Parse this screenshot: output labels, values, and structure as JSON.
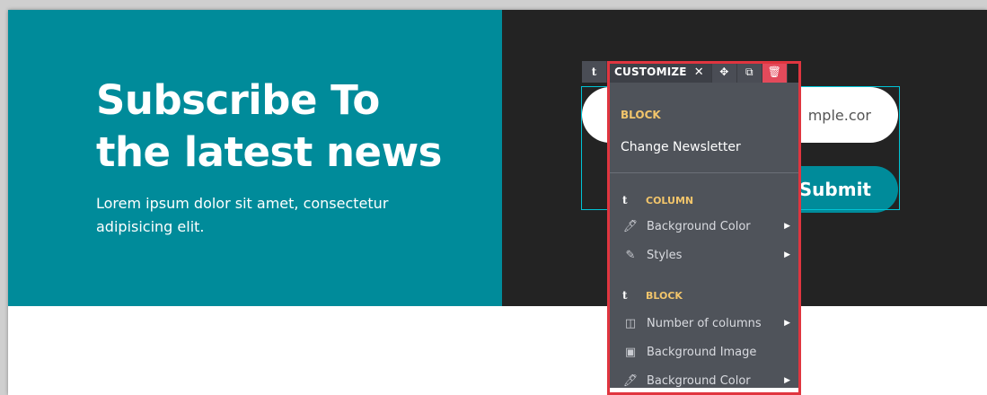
{
  "hero": {
    "headline_line1": "Subscribe To",
    "headline_line2": "the latest news",
    "lead": "Lorem ipsum dolor sit amet, consectetur adipisicing elit."
  },
  "form": {
    "email_value": "mple.cor",
    "submit_label": "Submit"
  },
  "toolbar": {
    "parent_icon": "t",
    "customize_label": "CUSTOMIZE",
    "close_glyph": "✕",
    "move_icon": "✥",
    "clone_icon": "⧉",
    "delete_icon": "🗑"
  },
  "menu": {
    "block_title": "BLOCK",
    "change_label": "Change Newsletter",
    "groups": [
      {
        "icon": "t",
        "title": "COLUMN",
        "items": [
          {
            "icon": "🖊",
            "label": "Background Color",
            "has_submenu": true
          },
          {
            "icon": "✎",
            "label": "Styles",
            "has_submenu": true
          }
        ]
      },
      {
        "icon": "t",
        "title": "BLOCK",
        "items": [
          {
            "icon": "◫",
            "label": "Number of columns",
            "has_submenu": true
          },
          {
            "icon": "▣",
            "label": "Background Image",
            "has_submenu": false
          },
          {
            "icon": "🖊",
            "label": "Background Color",
            "has_submenu": true
          }
        ]
      }
    ]
  },
  "colors": {
    "teal": "#008b9a",
    "dark": "#232323",
    "menu_bg": "#4f535a",
    "accent_gold": "#f2c56b",
    "delete_red": "#e34a5b",
    "highlight_red": "#e0353f",
    "selection_cyan": "#00c4d6"
  }
}
